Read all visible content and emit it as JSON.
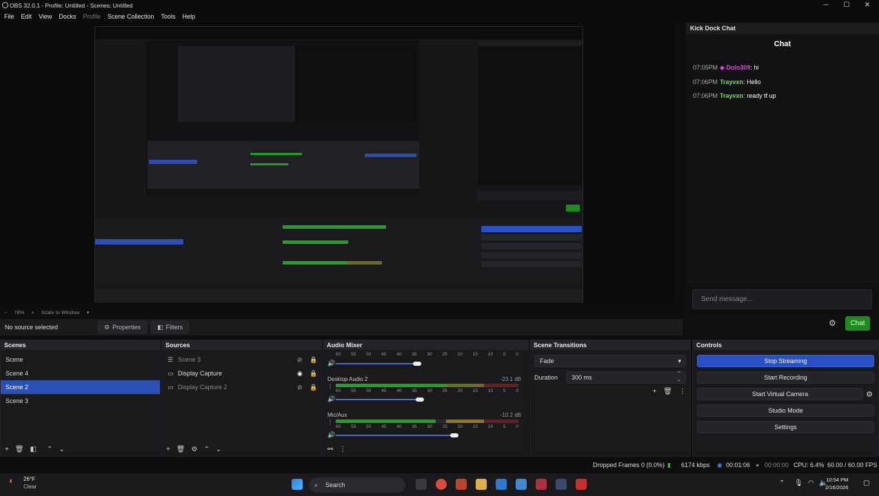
{
  "window": {
    "title": "OBS 32.0.1 - Profile: Untitled - Scenes: Untitled",
    "minimize": "─",
    "maximize": "☐",
    "close": "✕"
  },
  "menu": [
    "File",
    "Edit",
    "View",
    "Docks",
    "Profile",
    "Scene Collection",
    "Tools",
    "Help"
  ],
  "preview": {
    "zoom": "78%",
    "scale_mode": "Scale to Window"
  },
  "source_toolbar": {
    "no_source": "No source selected",
    "properties": "Properties",
    "filters": "Filters"
  },
  "chat_dock": {
    "header": "Kick Dock Chat",
    "title": "Chat",
    "messages": [
      {
        "time": "07:05PM",
        "user": "Dolo309",
        "text": "hi",
        "color": "#d44bd4"
      },
      {
        "time": "07:06PM",
        "user": "Trayvxn",
        "text": "Hello",
        "color": "#74e04a"
      },
      {
        "time": "07:06PM",
        "user": "Trayvxn",
        "text": "ready tf up",
        "color": "#74e04a"
      }
    ],
    "input_placeholder": "Send message...",
    "send_label": "Chat"
  },
  "scenes": {
    "header": "Scenes",
    "items": [
      "Scene",
      "Scene 4",
      "Scene 2",
      "Scene 3"
    ],
    "selected": "Scene 2"
  },
  "sources": {
    "header": "Sources",
    "items": [
      {
        "name": "Scene 3",
        "icon": "list-icon"
      },
      {
        "name": "Display Capture",
        "icon": "monitor-icon"
      },
      {
        "name": "Display Capture 2",
        "icon": "monitor-icon"
      }
    ]
  },
  "mixer": {
    "header": "Audio Mixer",
    "scale": [
      "60",
      "55",
      "50",
      "45",
      "40",
      "35",
      "30",
      "25",
      "20",
      "15",
      "10",
      "5",
      "0"
    ],
    "channels": [
      {
        "name": "Desktop Audio 2",
        "db": "-23.1 dB"
      },
      {
        "name": "Mic/Aux",
        "db": "-10.2 dB"
      }
    ]
  },
  "transitions": {
    "header": "Scene Transitions",
    "type": "Fade",
    "duration_label": "Duration",
    "duration": "300 ms"
  },
  "controls": {
    "header": "Controls",
    "buttons": [
      "Stop Streaming",
      "Start Recording",
      "Start Virtual Camera",
      "Studio Mode",
      "Settings"
    ]
  },
  "status": {
    "dropped": "Dropped Frames 0 (0.0%)",
    "bitrate": "6174 kbps",
    "stream_time": "00:01:06",
    "rec_time": "00:00:00",
    "cpu": "CPU: 6.4%",
    "fps": "60.00 / 60.00 FPS"
  },
  "taskbar": {
    "weather_temp": "26°F",
    "weather_desc": "Clear",
    "search": "Search",
    "time": "10:54 PM",
    "date": "2/16/2026"
  }
}
